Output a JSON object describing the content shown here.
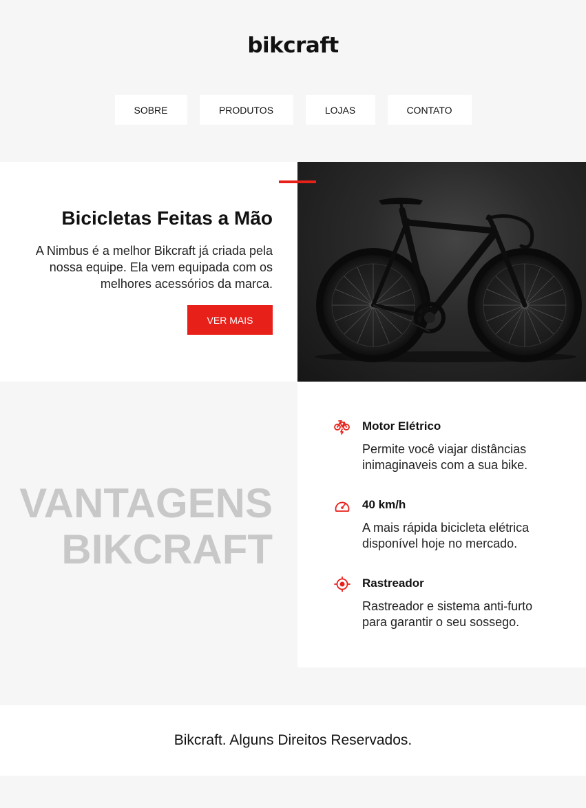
{
  "brand": {
    "logo": "bikcraft",
    "accent_color": "#e8201a"
  },
  "nav": {
    "items": [
      {
        "label": "SOBRE"
      },
      {
        "label": "PRODUTOS"
      },
      {
        "label": "LOJAS"
      },
      {
        "label": "CONTATO"
      }
    ]
  },
  "hero": {
    "title": "Bicicletas Feitas a Mão",
    "text": "A Nimbus é a melhor Bikcraft já criada pela nossa equipe. Ela vem equipada com os melhores acessórios da marca.",
    "button_label": "VER MAIS",
    "image_icon": "road-bike-photo"
  },
  "advantages": {
    "heading_line1": "VANTAGENS",
    "heading_line2": "BIKCRAFT",
    "items": [
      {
        "icon": "electric-bike-icon",
        "title": "Motor Elétrico",
        "text": "Permite você viajar distâncias inimaginaveis com a sua bike."
      },
      {
        "icon": "speedometer-icon",
        "title": "40 km/h",
        "text": "A mais rápida bicicleta elétrica disponível hoje no mercado."
      },
      {
        "icon": "target-icon",
        "title": "Rastreador",
        "text": "Rastreador e sistema anti-furto para garantir o seu sossego."
      }
    ]
  },
  "footer": {
    "text": "Bikcraft. Alguns Direitos Reservados."
  }
}
